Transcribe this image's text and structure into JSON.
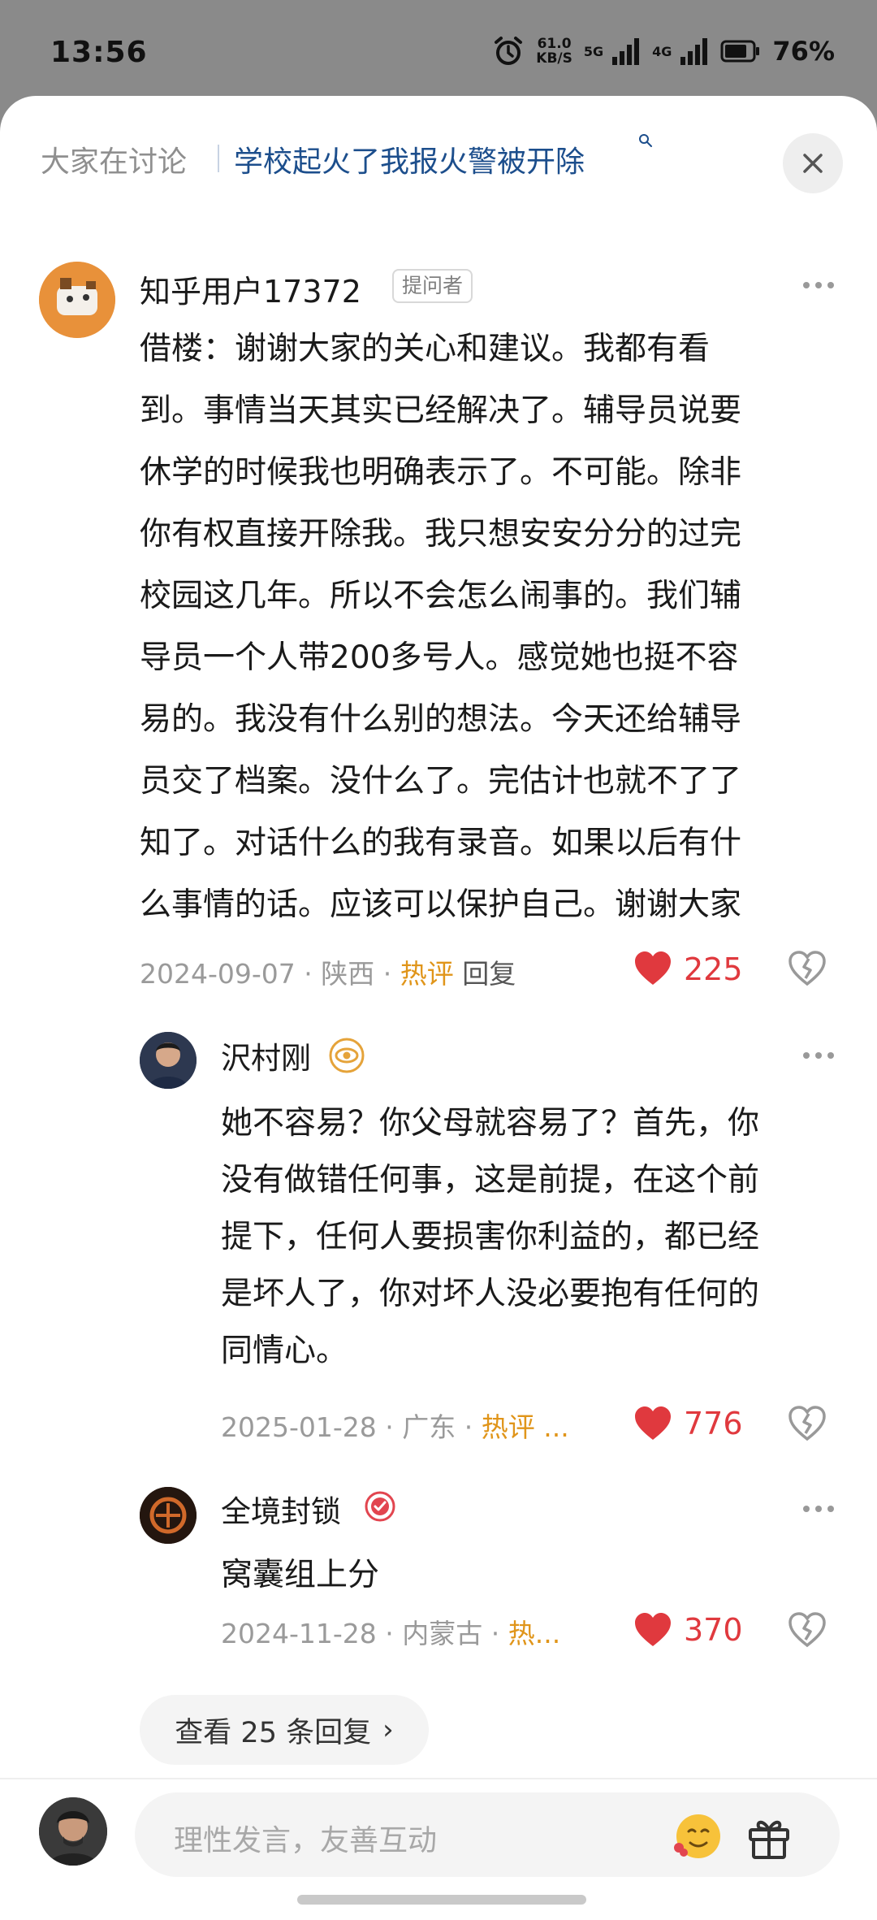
{
  "status": {
    "time": "13:56",
    "net_speed_value": "61.0",
    "net_speed_unit": "KB/S",
    "net_a": "5G",
    "net_b": "4G",
    "battery": "76%"
  },
  "header": {
    "prefix": "大家在讨论",
    "topic": "学校起火了我报火警被开除"
  },
  "main_comment": {
    "username": "知乎用户17372",
    "badge": "提问者",
    "lines": [
      "借楼：谢谢大家的关心和建议。我都有看",
      "到。事情当天其实已经解决了。辅导员说要",
      "休学的时候我也明确表示了。不可能。除非",
      "你有权直接开除我。我只想安安分分的过完",
      "校园这几年。所以不会怎么闹事的。我们辅",
      "导员一个人带200多号人。感觉她也挺不容",
      "易的。我没有什么别的想法。今天还给辅导",
      "员交了档案。没什么了。完估计也就不了了",
      "知了。对话什么的我有录音。如果以后有什",
      "么事情的话。应该可以保护自己。谢谢大家"
    ],
    "date": "2024-09-07",
    "location": "陕西",
    "hot": "热评",
    "reply": "回复",
    "likes": "225"
  },
  "replies": [
    {
      "username": "沢村刚",
      "lines": [
        "她不容易？你父母就容易了？首先，你",
        "没有做错任何事，这是前提，在这个前",
        "提下，任何人要损害你利益的，都已经",
        "是坏人了，你对坏人没必要抱有任何的",
        "同情心。"
      ],
      "date": "2025-01-28",
      "location": "广东",
      "hot": "热评 ...",
      "likes": "776"
    },
    {
      "username": "全境封锁",
      "lines": [
        "窝囊组上分"
      ],
      "date": "2024-11-28",
      "location": "内蒙古",
      "hot": "热...",
      "likes": "370"
    }
  ],
  "view_replies": {
    "label": "查看 25 条回复",
    "chevron": "›"
  },
  "compose": {
    "placeholder": "理性发言，友善互动"
  },
  "colors": {
    "accent_blue": "#1c4e8c",
    "like_red": "#e0393e",
    "hot_orange": "#e0951a"
  },
  "icons": [
    "alarm-icon",
    "signal-icon",
    "battery-icon",
    "search-icon",
    "close-icon",
    "more-icon",
    "heart-icon",
    "dislike-icon",
    "emoji-icon",
    "gift-icon"
  ]
}
